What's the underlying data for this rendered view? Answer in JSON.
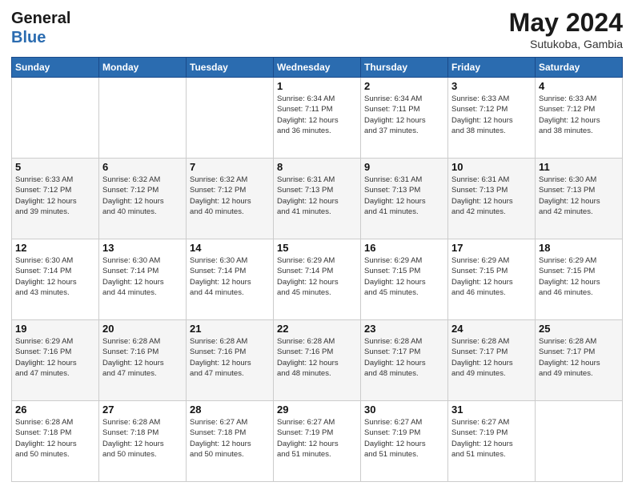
{
  "header": {
    "logo_line1": "General",
    "logo_line2": "Blue",
    "month_year": "May 2024",
    "location": "Sutukoba, Gambia"
  },
  "weekdays": [
    "Sunday",
    "Monday",
    "Tuesday",
    "Wednesday",
    "Thursday",
    "Friday",
    "Saturday"
  ],
  "weeks": [
    [
      {
        "day": "",
        "info": ""
      },
      {
        "day": "",
        "info": ""
      },
      {
        "day": "",
        "info": ""
      },
      {
        "day": "1",
        "info": "Sunrise: 6:34 AM\nSunset: 7:11 PM\nDaylight: 12 hours\nand 36 minutes."
      },
      {
        "day": "2",
        "info": "Sunrise: 6:34 AM\nSunset: 7:11 PM\nDaylight: 12 hours\nand 37 minutes."
      },
      {
        "day": "3",
        "info": "Sunrise: 6:33 AM\nSunset: 7:12 PM\nDaylight: 12 hours\nand 38 minutes."
      },
      {
        "day": "4",
        "info": "Sunrise: 6:33 AM\nSunset: 7:12 PM\nDaylight: 12 hours\nand 38 minutes."
      }
    ],
    [
      {
        "day": "5",
        "info": "Sunrise: 6:33 AM\nSunset: 7:12 PM\nDaylight: 12 hours\nand 39 minutes."
      },
      {
        "day": "6",
        "info": "Sunrise: 6:32 AM\nSunset: 7:12 PM\nDaylight: 12 hours\nand 40 minutes."
      },
      {
        "day": "7",
        "info": "Sunrise: 6:32 AM\nSunset: 7:12 PM\nDaylight: 12 hours\nand 40 minutes."
      },
      {
        "day": "8",
        "info": "Sunrise: 6:31 AM\nSunset: 7:13 PM\nDaylight: 12 hours\nand 41 minutes."
      },
      {
        "day": "9",
        "info": "Sunrise: 6:31 AM\nSunset: 7:13 PM\nDaylight: 12 hours\nand 41 minutes."
      },
      {
        "day": "10",
        "info": "Sunrise: 6:31 AM\nSunset: 7:13 PM\nDaylight: 12 hours\nand 42 minutes."
      },
      {
        "day": "11",
        "info": "Sunrise: 6:30 AM\nSunset: 7:13 PM\nDaylight: 12 hours\nand 42 minutes."
      }
    ],
    [
      {
        "day": "12",
        "info": "Sunrise: 6:30 AM\nSunset: 7:14 PM\nDaylight: 12 hours\nand 43 minutes."
      },
      {
        "day": "13",
        "info": "Sunrise: 6:30 AM\nSunset: 7:14 PM\nDaylight: 12 hours\nand 44 minutes."
      },
      {
        "day": "14",
        "info": "Sunrise: 6:30 AM\nSunset: 7:14 PM\nDaylight: 12 hours\nand 44 minutes."
      },
      {
        "day": "15",
        "info": "Sunrise: 6:29 AM\nSunset: 7:14 PM\nDaylight: 12 hours\nand 45 minutes."
      },
      {
        "day": "16",
        "info": "Sunrise: 6:29 AM\nSunset: 7:15 PM\nDaylight: 12 hours\nand 45 minutes."
      },
      {
        "day": "17",
        "info": "Sunrise: 6:29 AM\nSunset: 7:15 PM\nDaylight: 12 hours\nand 46 minutes."
      },
      {
        "day": "18",
        "info": "Sunrise: 6:29 AM\nSunset: 7:15 PM\nDaylight: 12 hours\nand 46 minutes."
      }
    ],
    [
      {
        "day": "19",
        "info": "Sunrise: 6:29 AM\nSunset: 7:16 PM\nDaylight: 12 hours\nand 47 minutes."
      },
      {
        "day": "20",
        "info": "Sunrise: 6:28 AM\nSunset: 7:16 PM\nDaylight: 12 hours\nand 47 minutes."
      },
      {
        "day": "21",
        "info": "Sunrise: 6:28 AM\nSunset: 7:16 PM\nDaylight: 12 hours\nand 47 minutes."
      },
      {
        "day": "22",
        "info": "Sunrise: 6:28 AM\nSunset: 7:16 PM\nDaylight: 12 hours\nand 48 minutes."
      },
      {
        "day": "23",
        "info": "Sunrise: 6:28 AM\nSunset: 7:17 PM\nDaylight: 12 hours\nand 48 minutes."
      },
      {
        "day": "24",
        "info": "Sunrise: 6:28 AM\nSunset: 7:17 PM\nDaylight: 12 hours\nand 49 minutes."
      },
      {
        "day": "25",
        "info": "Sunrise: 6:28 AM\nSunset: 7:17 PM\nDaylight: 12 hours\nand 49 minutes."
      }
    ],
    [
      {
        "day": "26",
        "info": "Sunrise: 6:28 AM\nSunset: 7:18 PM\nDaylight: 12 hours\nand 50 minutes."
      },
      {
        "day": "27",
        "info": "Sunrise: 6:28 AM\nSunset: 7:18 PM\nDaylight: 12 hours\nand 50 minutes."
      },
      {
        "day": "28",
        "info": "Sunrise: 6:27 AM\nSunset: 7:18 PM\nDaylight: 12 hours\nand 50 minutes."
      },
      {
        "day": "29",
        "info": "Sunrise: 6:27 AM\nSunset: 7:19 PM\nDaylight: 12 hours\nand 51 minutes."
      },
      {
        "day": "30",
        "info": "Sunrise: 6:27 AM\nSunset: 7:19 PM\nDaylight: 12 hours\nand 51 minutes."
      },
      {
        "day": "31",
        "info": "Sunrise: 6:27 AM\nSunset: 7:19 PM\nDaylight: 12 hours\nand 51 minutes."
      },
      {
        "day": "",
        "info": ""
      }
    ]
  ]
}
